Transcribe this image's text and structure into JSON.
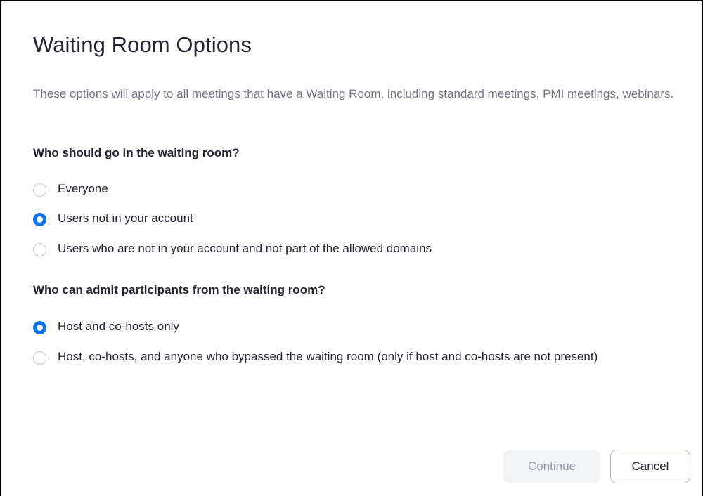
{
  "dialog": {
    "title": "Waiting Room Options",
    "description": "These options will apply to all meetings that have a Waiting Room, including standard meetings, PMI meetings, webinars."
  },
  "who_goes": {
    "heading": "Who should go in the waiting room?",
    "options": [
      {
        "label": "Everyone",
        "selected": false
      },
      {
        "label": "Users not in your account",
        "selected": true
      },
      {
        "label": "Users who are not in your account and not part of the allowed domains",
        "selected": false
      }
    ]
  },
  "who_admits": {
    "heading": "Who can admit participants from the waiting room?",
    "options": [
      {
        "label": "Host and co-hosts only",
        "selected": true
      },
      {
        "label": "Host, co-hosts, and anyone who bypassed the waiting room (only if host and co-hosts are not present)",
        "selected": false
      }
    ]
  },
  "footer": {
    "continue_label": "Continue",
    "cancel_label": "Cancel"
  },
  "colors": {
    "accent": "#0e72ed",
    "muted_text": "#747487",
    "primary_text": "#232333",
    "disabled_button_bg": "#f1f4f7"
  }
}
